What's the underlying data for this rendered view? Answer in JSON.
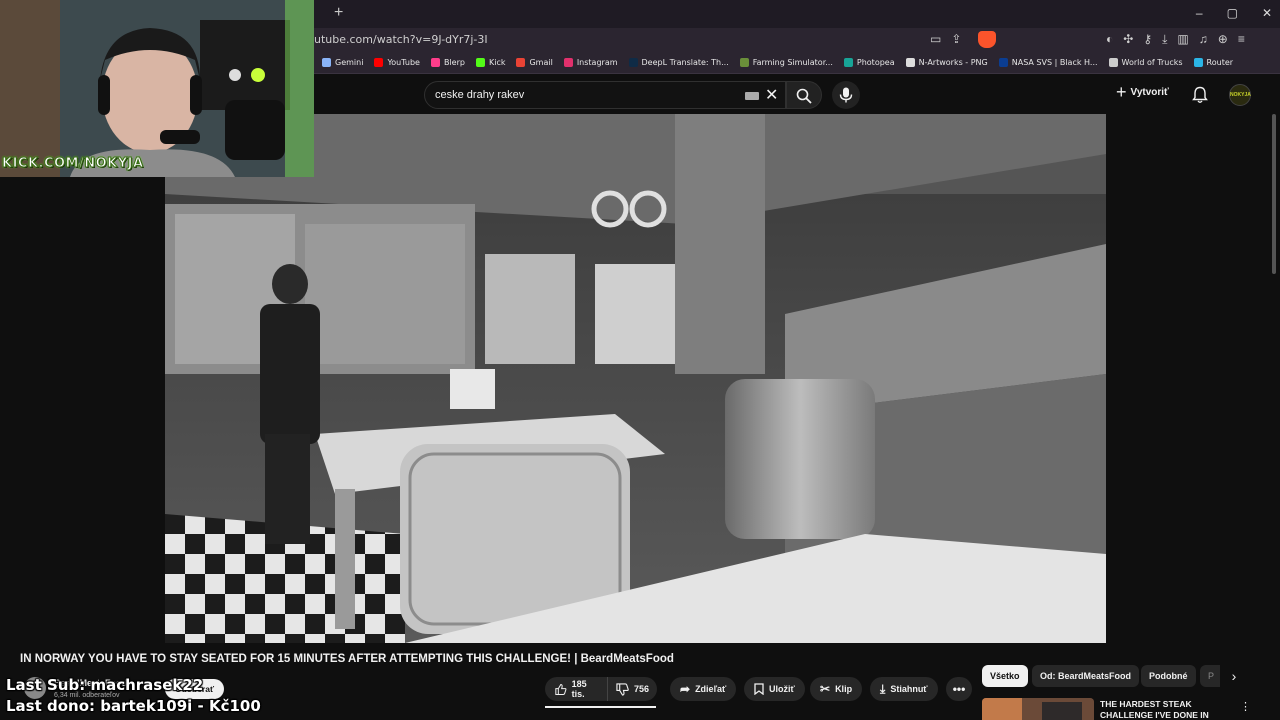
{
  "browser": {
    "new_tab_label": "+",
    "url": "utube.com/watch?v=9J-dYr7j-3I",
    "window_controls": [
      "–",
      "▢",
      "✕"
    ]
  },
  "bookmarks": [
    {
      "label": "Gemini",
      "color": "#8ab4f8"
    },
    {
      "label": "YouTube",
      "color": "#ff0000"
    },
    {
      "label": "Blerp",
      "color": "#ff3d8b"
    },
    {
      "label": "Kick",
      "color": "#53fc18"
    },
    {
      "label": "Gmail",
      "color": "#ea4335"
    },
    {
      "label": "Instagram",
      "color": "#e1306c"
    },
    {
      "label": "DeepL Translate: Th...",
      "color": "#0f2b46"
    },
    {
      "label": "Farming Simulator...",
      "color": "#6a8f3a"
    },
    {
      "label": "Photopea",
      "color": "#18a497"
    },
    {
      "label": "N-Artworks - PNG",
      "color": "#dddddd"
    },
    {
      "label": "NASA SVS | Black H...",
      "color": "#0b3d91"
    },
    {
      "label": "World of Trucks",
      "color": "#cccccc"
    },
    {
      "label": "Router",
      "color": "#2bb5e6"
    }
  ],
  "youtube": {
    "search_value": "ceske drahy rakev",
    "create_label": "Vytvoriť",
    "avatar_text": "NOKYJA"
  },
  "webcam": {
    "label": "KICK.COM/NOKYJA"
  },
  "video": {
    "title": "IN NORWAY YOU HAVE TO STAY SEATED FOR 15 MINUTES AFTER ATTEMPTING THIS CHALLENGE! | BeardMeatsFood",
    "channel_name": "BeardMeatsFood",
    "channel_subs": "6,34 mil. odberateľov",
    "subscribe_label": "Odoberať",
    "likes": "185 tis.",
    "dislikes": "756",
    "share_label": "Zdieľať",
    "save_label": "Uložiť",
    "clip_label": "Klip",
    "download_label": "Stiahnuť",
    "more_label": "•••"
  },
  "chips": {
    "all": "Všetko",
    "from": "Od: BeardMeatsFood",
    "similar": "Podobné",
    "partial": "P"
  },
  "recommendation": {
    "title": "THE HARDEST STEAK CHALLENGE I'VE DONE IN"
  },
  "overlay": {
    "last_sub": "Last Sub: machrasek22",
    "last_dono": "Last dono: bartek109i - Kč100"
  }
}
